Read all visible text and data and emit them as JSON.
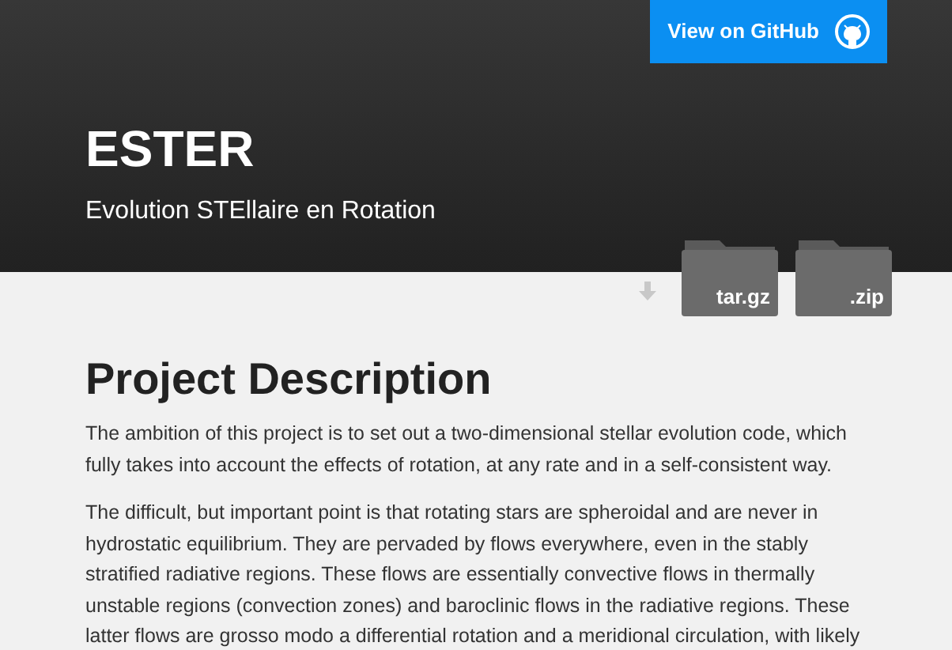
{
  "header": {
    "title": "ESTER",
    "subtitle": "Evolution STEllaire en Rotation",
    "github_button": "View on GitHub"
  },
  "downloads": [
    {
      "label": "tar.gz"
    },
    {
      "label": ".zip"
    }
  ],
  "section": {
    "heading": "Project Description",
    "paragraphs": [
      "The ambition of this project is to set out a two-dimensional stellar evolution code, which fully takes into account the effects of rotation, at any rate and in a self-consistent way.",
      "The difficult, but important point is that rotating stars are spheroidal and are never in hydrostatic equilibrium. They are pervaded by flows everywhere, even in the stably stratified radiative regions. These flows are essentially convective flows in thermally unstable regions (convection zones) and baroclinic flows in the radiative regions. These latter flows are grosso modo a differential rotation and a meridional circulation, with likely"
    ]
  }
}
